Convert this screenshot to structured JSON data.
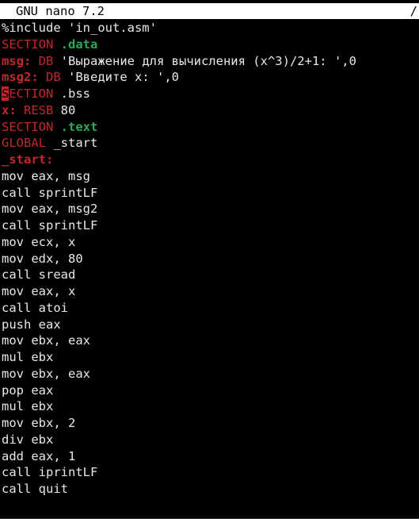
{
  "titlebar": {
    "app_name": "GNU nano 7.2",
    "right_text": "/"
  },
  "colors": {
    "background": "#000000",
    "titlebar_bg": "#ffffff",
    "directive": "#c2282b",
    "section_name": "#2ba85a",
    "text": "#e8e8e8"
  },
  "editor": {
    "lines": [
      [
        {
          "t": "%include 'in_out.asm'",
          "c": "plain"
        }
      ],
      [
        {
          "t": "SECTION",
          "c": "directive"
        },
        {
          "t": " ",
          "c": "plain"
        },
        {
          "t": ".data",
          "c": "section"
        }
      ],
      [
        {
          "t": "msg:",
          "c": "label"
        },
        {
          "t": " ",
          "c": "plain"
        },
        {
          "t": "DB",
          "c": "directive"
        },
        {
          "t": " 'Выражение для вычисления (x^3)/2+1: ',0",
          "c": "plain"
        }
      ],
      [
        {
          "t": "msg2:",
          "c": "label"
        },
        {
          "t": " ",
          "c": "plain"
        },
        {
          "t": "DB",
          "c": "directive"
        },
        {
          "t": " 'Введите x: ',0",
          "c": "plain"
        }
      ],
      [
        {
          "t": "S",
          "c": "cursor"
        },
        {
          "t": "ECTION",
          "c": "directive"
        },
        {
          "t": " .bss",
          "c": "plain"
        }
      ],
      [
        {
          "t": "x:",
          "c": "label"
        },
        {
          "t": " ",
          "c": "plain"
        },
        {
          "t": "RESB",
          "c": "directive"
        },
        {
          "t": " 80",
          "c": "plain"
        }
      ],
      [
        {
          "t": "SECTION",
          "c": "directive"
        },
        {
          "t": " ",
          "c": "plain"
        },
        {
          "t": ".text",
          "c": "section"
        }
      ],
      [
        {
          "t": "GLOBAL",
          "c": "directive"
        },
        {
          "t": " _start",
          "c": "plain"
        }
      ],
      [
        {
          "t": "_start:",
          "c": "label"
        }
      ],
      [
        {
          "t": "mov eax, msg",
          "c": "plain"
        }
      ],
      [
        {
          "t": "call sprintLF",
          "c": "plain"
        }
      ],
      [
        {
          "t": "mov eax, msg2",
          "c": "plain"
        }
      ],
      [
        {
          "t": "call sprintLF",
          "c": "plain"
        }
      ],
      [
        {
          "t": "mov ecx, x",
          "c": "plain"
        }
      ],
      [
        {
          "t": "mov edx, 80",
          "c": "plain"
        }
      ],
      [
        {
          "t": "call sread",
          "c": "plain"
        }
      ],
      [
        {
          "t": "mov eax, x",
          "c": "plain"
        }
      ],
      [
        {
          "t": "call atoi",
          "c": "plain"
        }
      ],
      [
        {
          "t": "push eax",
          "c": "plain"
        }
      ],
      [
        {
          "t": "mov ebx, eax",
          "c": "plain"
        }
      ],
      [
        {
          "t": "mul ebx",
          "c": "plain"
        }
      ],
      [
        {
          "t": "mov ebx, eax",
          "c": "plain"
        }
      ],
      [
        {
          "t": "pop eax",
          "c": "plain"
        }
      ],
      [
        {
          "t": "mul ebx",
          "c": "plain"
        }
      ],
      [
        {
          "t": "mov ebx, 2",
          "c": "plain"
        }
      ],
      [
        {
          "t": "div ebx",
          "c": "plain"
        }
      ],
      [
        {
          "t": "add eax, 1",
          "c": "plain"
        }
      ],
      [
        {
          "t": "call iprintLF",
          "c": "plain"
        }
      ],
      [
        {
          "t": "call quit",
          "c": "plain"
        }
      ]
    ]
  }
}
